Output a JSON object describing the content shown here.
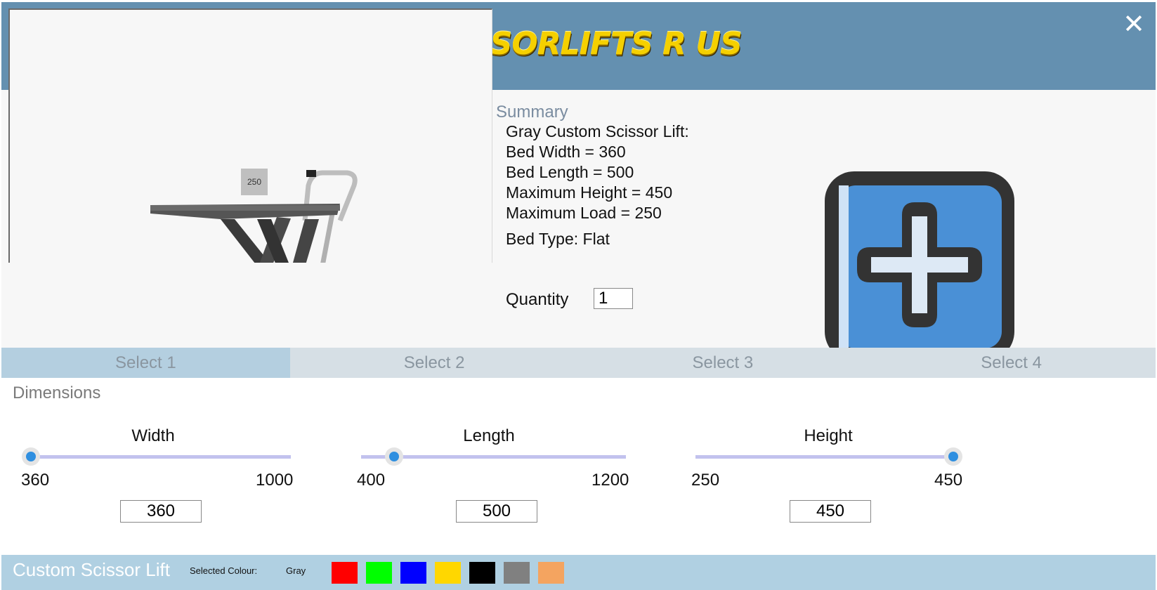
{
  "header": {
    "logo_text": "SCISSORLIFTS R US",
    "close_label": "✕"
  },
  "preview": {
    "load_tag": "250"
  },
  "summary": {
    "title": "Summary",
    "lines": [
      "Gray Custom Scissor Lift:",
      "Bed Width = 360",
      "Bed Length = 500",
      "Maximum Height = 450",
      "Maximum Load = 250"
    ],
    "bed_type": "Bed Type: Flat",
    "quantity_label": "Quantity",
    "quantity_value": "1"
  },
  "tabs": [
    {
      "label": "Select 1",
      "active": true
    },
    {
      "label": "Select 2",
      "active": false
    },
    {
      "label": "Select 3",
      "active": false
    },
    {
      "label": "Select 4",
      "active": false
    }
  ],
  "dimensions": {
    "title": "Dimensions",
    "sliders": [
      {
        "label": "Width",
        "min": "360",
        "max": "1000",
        "value": "360",
        "fraction": 0.0
      },
      {
        "label": "Length",
        "min": "400",
        "max": "1200",
        "value": "500",
        "fraction": 0.125
      },
      {
        "label": "Height",
        "min": "250",
        "max": "450",
        "value": "450",
        "fraction": 1.0
      }
    ]
  },
  "footer": {
    "title": "Custom Scissor Lift",
    "selected_colour_label": "Selected Colour:",
    "selected_colour_value": "Gray",
    "swatches": [
      "#ff0000",
      "#00ff00",
      "#0000ff",
      "#ffd700",
      "#000000",
      "#808080",
      "#f4a460"
    ]
  },
  "colors": {
    "header_bg": "#6490b0",
    "tab_active": "#b4cfe0",
    "accent": "#2f8fe0"
  }
}
